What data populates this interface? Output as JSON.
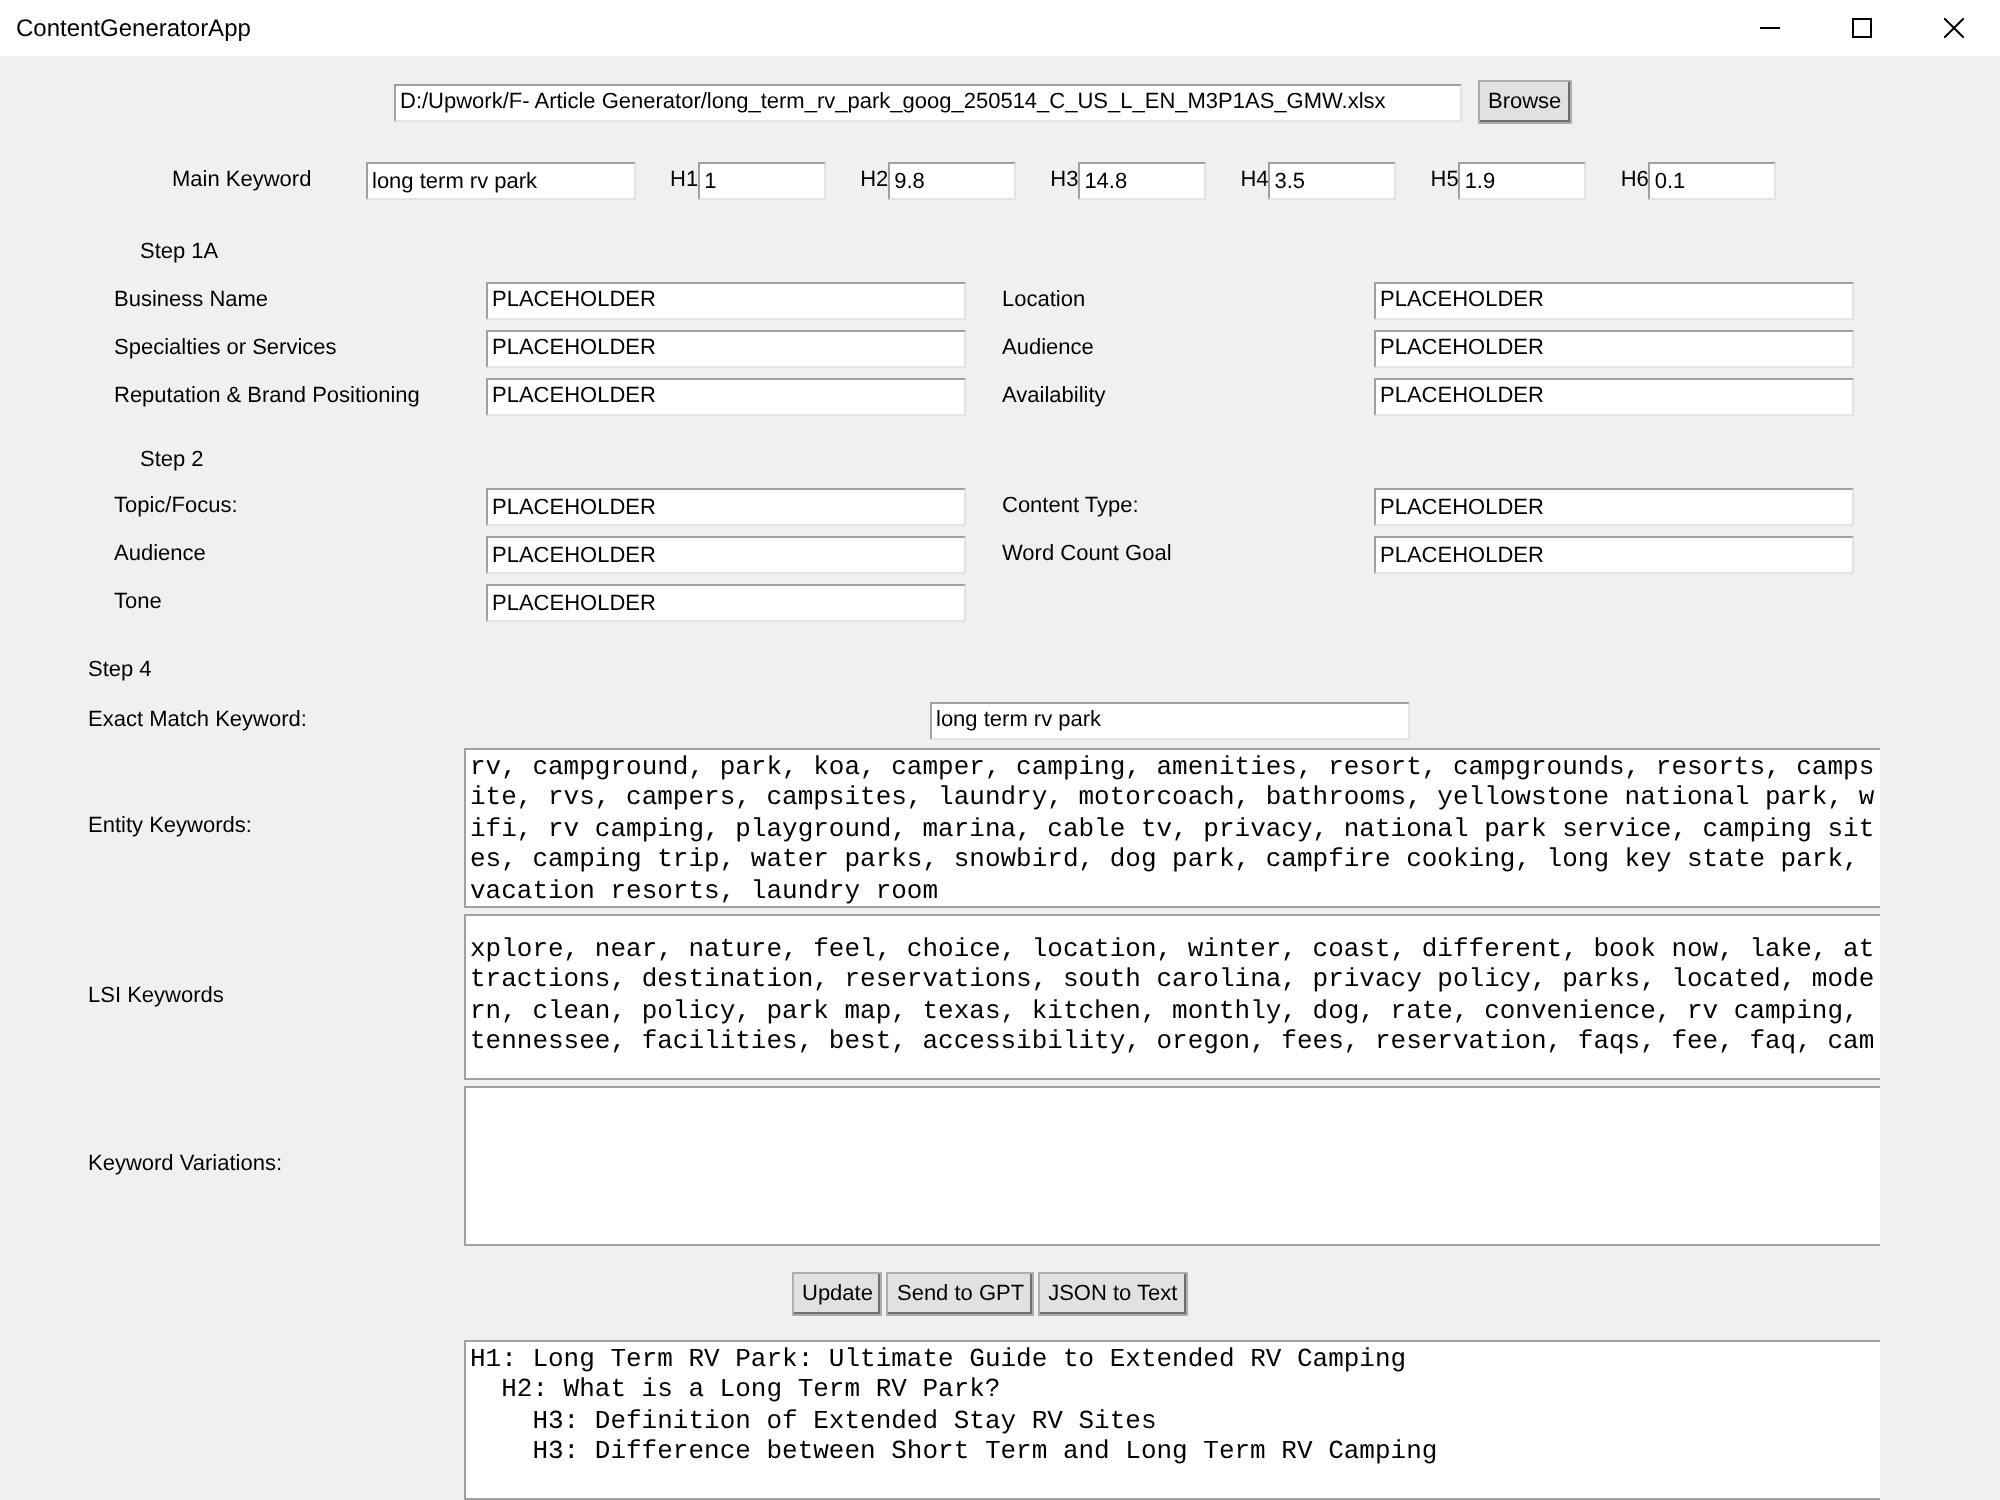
{
  "window": {
    "title": "ContentGeneratorApp"
  },
  "file": {
    "path": "D:/Upwork/F- Article Generator/long_term_rv_park_goog_250514_C_US_L_EN_M3P1AS_GMW.xlsx",
    "button": "Browse"
  },
  "keywords": {
    "main": {
      "label": "Main Keyword",
      "value": "long term rv park"
    },
    "headings": [
      {
        "label": "H1",
        "value": "1"
      },
      {
        "label": "H2",
        "value": "9.8"
      },
      {
        "label": "H3",
        "value": "14.8"
      },
      {
        "label": "H4",
        "value": "3.5"
      },
      {
        "label": "H5",
        "value": "1.9"
      },
      {
        "label": "H6",
        "value": "0.1"
      }
    ]
  },
  "steps": [
    {
      "title": "Step 1A",
      "fields": [
        {
          "label": "Business Name",
          "value": "PLACEHOLDER"
        },
        {
          "label": "Location",
          "value": "PLACEHOLDER"
        },
        {
          "label": "Specialties or Services",
          "value": "PLACEHOLDER"
        },
        {
          "label": "Audience",
          "value": "PLACEHOLDER"
        },
        {
          "label": "Reputation & Brand Positioning",
          "value": "PLACEHOLDER"
        },
        {
          "label": "Availability",
          "value": "PLACEHOLDER"
        }
      ]
    },
    {
      "title": "Step 2",
      "fields": [
        {
          "label": "Topic/Focus:",
          "value": "PLACEHOLDER"
        },
        {
          "label": "Content Type:",
          "value": "PLACEHOLDER"
        },
        {
          "label": "Audience",
          "value": "PLACEHOLDER"
        },
        {
          "label": "Word Count Goal",
          "value": "PLACEHOLDER"
        },
        {
          "label": "Tone",
          "value": "PLACEHOLDER"
        }
      ]
    }
  ],
  "step4": {
    "title": "Step 4",
    "exact_match": {
      "label": "Exact Match Keyword:",
      "value": "long term rv park"
    },
    "text_areas": [
      {
        "label": "Entity Keywords:",
        "text": "rv, campground, park, koa, camper, camping, amenities, resort, campgrounds, resorts, campsite, rvs, campers, campsites, laundry, motorcoach, bathrooms, yellowstone national park, wifi, rv camping, playground, marina, cable tv, privacy, national park service, camping sites, camping trip, water parks, snowbird, dog park, campfire cooking, long key state park, vacation resorts, laundry room"
      },
      {
        "label": "LSI Keywords",
        "text": "xplore, near, nature, feel, choice, location, winter, coast, different, book now, lake, attractions, destination, reservations, south carolina, privacy policy, parks, located, modern, clean, policy, park map, texas, kitchen, monthly, dog, rate, convenience, rv camping, tennessee, facilities, best, accessibility, oregon, fees, reservation, faqs, fee, faq, cam"
      },
      {
        "label": "Keyword Variations:"
      }
    ]
  },
  "buttons": [
    "Update",
    "Send to GPT",
    "JSON to Text"
  ],
  "outline": [
    {
      "text": "H1: Long Term RV Park: Ultimate Guide to Extended RV Camping",
      "children": [
        {
          "text": "H2: What is a Long Term RV Park?",
          "children": [
            {
              "text": "H3: Definition of Extended Stay RV Sites"
            },
            {
              "text": "H3: Difference between Short Term and Long Term RV Camping"
            }
          ]
        }
      ]
    }
  ]
}
